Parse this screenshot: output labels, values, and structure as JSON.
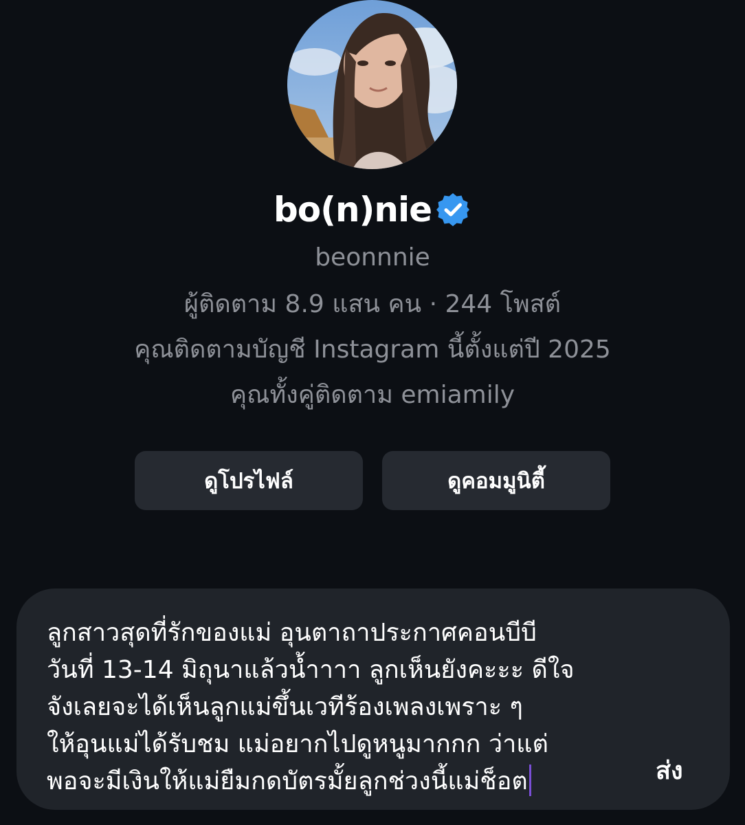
{
  "profile": {
    "display_name": "bo(n)nie",
    "handle": "beonnnie",
    "stats": "ผู้ติดตาม 8.9 แสน คน · 244 โพสต์",
    "follow_since": "คุณติดตามบัญชี Instagram นี้ตั้งแต่ปี 2025",
    "mutual": "คุณทั้งคู่ติดตาม emiamily",
    "verified_icon": "verified-badge-icon",
    "verified_color": "#3797f0"
  },
  "actions": {
    "view_profile": "ดูโปรไฟล์",
    "view_community": "ดูคอมมูนิตี้"
  },
  "composer": {
    "text": "ลูกสาวสุดที่รักของแม่ อุนตาถาประกาศคอนบีบี\nวันที่ 13-14 มิถุนาแล้วน้ำาาา ลูกเห็นยังคะะะ ดีใจ\nจังเลยจะได้เห็นลูกแม่ขึ้นเวทีร้องเพลงเพราะ ๆ\nให้อุนแม่ได้รับชม แม่อยากไปดูหนูมากกก ว่าแต่\nพอจะมีเงินให้แม่ยืมกดบัตรมั้ยลูกช่วงนี้แม่ช็อต",
    "send_label": "ส่ง",
    "caret_color": "#7a4fd6"
  },
  "colors": {
    "background": "#0c0f14",
    "button_bg": "#262a31",
    "composer_bg": "#20242a",
    "secondary_text": "#8e9198"
  }
}
